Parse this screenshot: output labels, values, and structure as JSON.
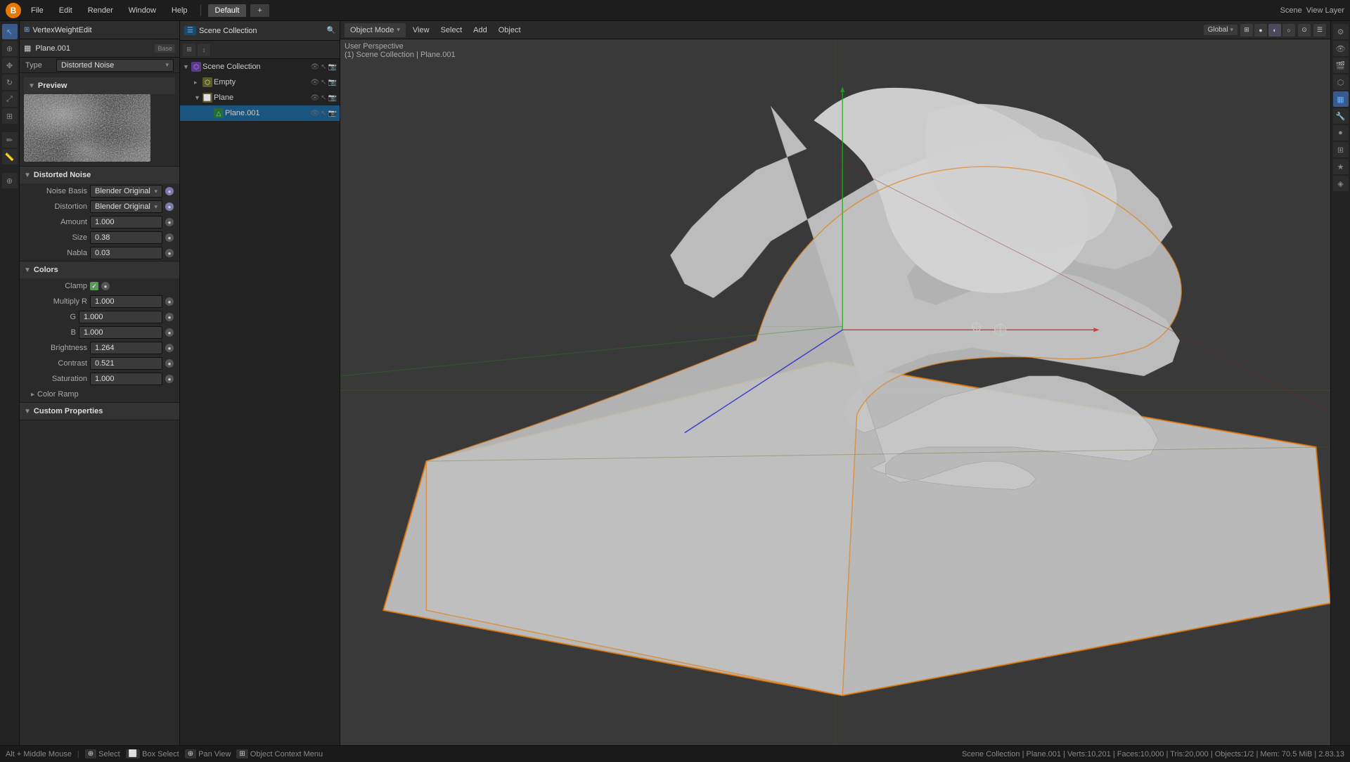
{
  "app": {
    "title": "Blender",
    "logo": "B",
    "workspace": "Default"
  },
  "top_menu": {
    "items": [
      "File",
      "Edit",
      "Render",
      "Window",
      "Help"
    ]
  },
  "workspace_tabs": [
    {
      "label": "Default",
      "active": true
    },
    {
      "label": "+",
      "active": false
    }
  ],
  "top_right": {
    "scene_label": "Scene",
    "view_layer_label": "View Layer"
  },
  "object_header": {
    "icon": "▦",
    "name": "Plane.001",
    "base_icon": "B",
    "base_name": "Base"
  },
  "modifier_header": {
    "icon": "⊞",
    "name": "VertexWeightEdit"
  },
  "type_row": {
    "label": "Type",
    "value": "Distorted Noise"
  },
  "preview": {
    "label": "Preview"
  },
  "distorted_noise": {
    "section_title": "Distorted Noise",
    "noise_basis_label": "Noise Basis",
    "noise_basis_value": "Blender Original",
    "distortion_label": "Distortion",
    "distortion_value": "Blender Original",
    "amount_label": "Amount",
    "amount_value": "1.000",
    "size_label": "Size",
    "size_value": "0.38",
    "nabla_label": "Nabla",
    "nabla_value": "0.03"
  },
  "colors": {
    "section_title": "Colors",
    "clamp_label": "Clamp",
    "clamp_checked": true,
    "multiply_r_label": "Multiply R",
    "multiply_r_value": "1.000",
    "g_label": "G",
    "g_value": "1.000",
    "b_label": "B",
    "b_value": "1.000",
    "brightness_label": "Brightness",
    "brightness_value": "1.264",
    "contrast_label": "Contrast",
    "contrast_value": "0.521",
    "saturation_label": "Saturation",
    "saturation_value": "1.000",
    "color_ramp_label": "Color Ramp"
  },
  "custom_properties": {
    "section_title": "Custom Properties"
  },
  "outliner": {
    "title": "Scene Collection",
    "items": [
      {
        "name": "Scene Collection",
        "type": "scene",
        "indent": 0,
        "expanded": true
      },
      {
        "name": "Empty",
        "type": "collection",
        "indent": 1,
        "expanded": false
      },
      {
        "name": "Plane",
        "type": "empty",
        "indent": 1,
        "expanded": true
      },
      {
        "name": "Plane.001",
        "type": "mesh",
        "indent": 2,
        "expanded": false,
        "active": true
      }
    ]
  },
  "viewport": {
    "mode": "Object Mode",
    "view_label": "View",
    "select_label": "Select",
    "add_label": "Add",
    "object_label": "Object",
    "overlay_line1": "User Perspective",
    "overlay_line2": "(1) Scene Collection | Plane.001",
    "shading_label": "Global"
  },
  "status_bar": {
    "shortcut": "Alt + Middle Mouse",
    "select_label": "Select",
    "box_select_label": "Box Select",
    "pan_view_label": "Pan View",
    "context_menu_label": "Object Context Menu",
    "scene_info": "Scene Collection | Plane.001 | Verts:10,201 | Faces:10,000 | Tris:20,000 | Objects:1/2 | Mem: 70.5 MiB | 2.83.13"
  },
  "icons": {
    "arrow_right": "▶",
    "arrow_down": "▼",
    "eye": "👁",
    "cursor": "⊕",
    "move": "✥",
    "transform": "⤢",
    "select_box": "⬜",
    "checkbox_checked": "✓",
    "chevron_down": "▾",
    "chevron_right": "▸",
    "dot": "●",
    "gear": "⚙",
    "camera": "📷",
    "light": "💡",
    "mesh_icon": "△",
    "collection_icon": "⬡",
    "scene_icon": "🎬",
    "close": "✕",
    "add": "+"
  }
}
